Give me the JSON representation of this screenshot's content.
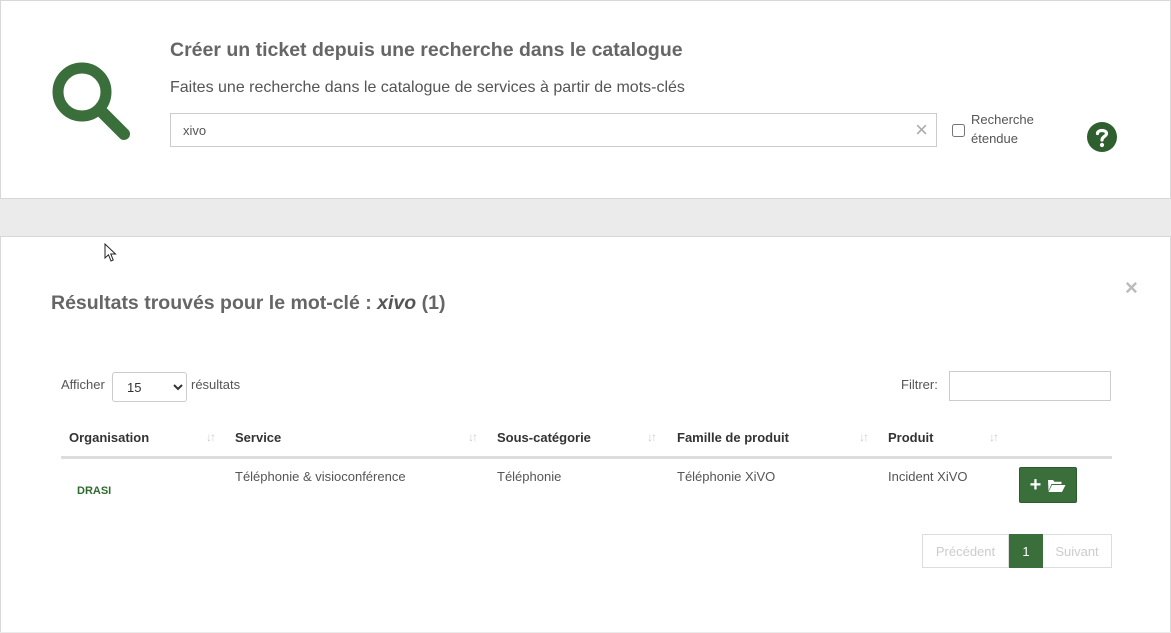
{
  "header": {
    "title": "Créer un ticket depuis une recherche dans le catalogue",
    "subtitle": "Faites une recherche dans le catalogue de services à partir de mots-clés",
    "search_value": "xivo",
    "clear_icon": "×",
    "extended_search_label": "Recherche étendue",
    "extended_search_checked": false,
    "icons": {
      "big": "search-icon",
      "help": "help-icon"
    },
    "accent": "#3a6e3a"
  },
  "results": {
    "title_prefix": "Résultats trouvés pour le mot-clé :",
    "keyword": "xivo",
    "count": "(1)",
    "close_icon": "×",
    "show_label": "Afficher",
    "page_size": "15",
    "page_size_options": [
      "15"
    ],
    "results_label": "résultats",
    "filter_label": "Filtrer:",
    "filter_value": "",
    "columns": [
      "Organisation",
      "Service",
      "Sous-catégorie",
      "Famille de produit",
      "Produit"
    ],
    "rows": [
      {
        "organisation": "DRASI",
        "service": "Téléphonie & visioconférence",
        "sous_categorie": "Téléphonie",
        "famille": "Téléphonie XiVO",
        "produit": "Incident XiVO"
      }
    ],
    "pagination": {
      "previous": "Précédent",
      "current": "1",
      "next": "Suivant"
    }
  }
}
